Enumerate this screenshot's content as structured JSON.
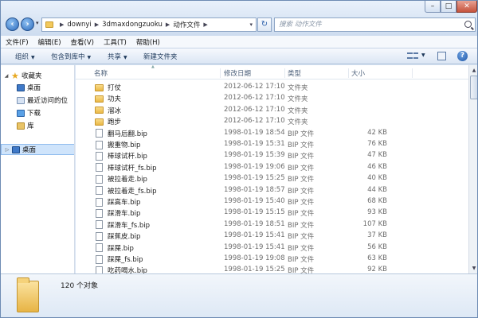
{
  "address": {
    "segments": [
      "downyi",
      "3dmaxdongzuoku",
      "动作文件"
    ]
  },
  "search": {
    "placeholder": "搜索 动作文件"
  },
  "menu": [
    "文件(F)",
    "编辑(E)",
    "查看(V)",
    "工具(T)",
    "帮助(H)"
  ],
  "toolbar": {
    "organize": "组织",
    "include_library": "包含到库中",
    "share": "共享",
    "new_folder": "新建文件夹"
  },
  "nav": {
    "favorites": "收藏夹",
    "desktop_fav": "桌面",
    "recent": "最近访问的位",
    "downloads": "下载",
    "libraries": "库",
    "desktop": "桌面"
  },
  "columns": {
    "name": "名称",
    "date": "修改日期",
    "type": "类型",
    "size": "大小"
  },
  "files": [
    {
      "name": "打仗",
      "date": "2012-06-12 17:10",
      "type": "文件夹",
      "size": "",
      "kind": "folder"
    },
    {
      "name": "功夫",
      "date": "2012-06-12 17:10",
      "type": "文件夹",
      "size": "",
      "kind": "folder"
    },
    {
      "name": "溜冰",
      "date": "2012-06-12 17:10",
      "type": "文件夹",
      "size": "",
      "kind": "folder"
    },
    {
      "name": "跑步",
      "date": "2012-06-12 17:10",
      "type": "文件夹",
      "size": "",
      "kind": "folder"
    },
    {
      "name": "翻马后翻.bip",
      "date": "1998-01-19 18:54",
      "type": "BIP 文件",
      "size": "42 KB",
      "kind": "file"
    },
    {
      "name": "搬重物.bip",
      "date": "1998-01-19 15:31",
      "type": "BIP 文件",
      "size": "76 KB",
      "kind": "file"
    },
    {
      "name": "棒球试杆.bip",
      "date": "1998-01-19 15:39",
      "type": "BIP 文件",
      "size": "47 KB",
      "kind": "file"
    },
    {
      "name": "棒球试杆_fs.bip",
      "date": "1998-01-19 19:06",
      "type": "BIP 文件",
      "size": "46 KB",
      "kind": "file"
    },
    {
      "name": "被拉着走.bip",
      "date": "1998-01-19 15:25",
      "type": "BIP 文件",
      "size": "40 KB",
      "kind": "file"
    },
    {
      "name": "被拉着走_fs.bip",
      "date": "1998-01-19 18:57",
      "type": "BIP 文件",
      "size": "44 KB",
      "kind": "file"
    },
    {
      "name": "踩高车.bip",
      "date": "1998-01-19 15:40",
      "type": "BIP 文件",
      "size": "68 KB",
      "kind": "file"
    },
    {
      "name": "踩滑车.bip",
      "date": "1998-01-19 15:15",
      "type": "BIP 文件",
      "size": "93 KB",
      "kind": "file"
    },
    {
      "name": "踩滑车_fs.bip",
      "date": "1998-01-19 18:51",
      "type": "BIP 文件",
      "size": "107 KB",
      "kind": "file"
    },
    {
      "name": "踩蕉皮.bip",
      "date": "1998-01-19 15:41",
      "type": "BIP 文件",
      "size": "37 KB",
      "kind": "file"
    },
    {
      "name": "踩屎.bip",
      "date": "1998-01-19 15:41",
      "type": "BIP 文件",
      "size": "56 KB",
      "kind": "file"
    },
    {
      "name": "踩屎_fs.bip",
      "date": "1998-01-19 19:08",
      "type": "BIP 文件",
      "size": "63 KB",
      "kind": "file"
    },
    {
      "name": "吃药喝水.bip",
      "date": "1998-01-19 15:25",
      "type": "BIP 文件",
      "size": "92 KB",
      "kind": "file"
    }
  ],
  "details": {
    "count": "120 个对象"
  },
  "colors": {
    "selection": "#cfe4fb",
    "frame": "#dbe7f5",
    "folder": "#eab846"
  }
}
